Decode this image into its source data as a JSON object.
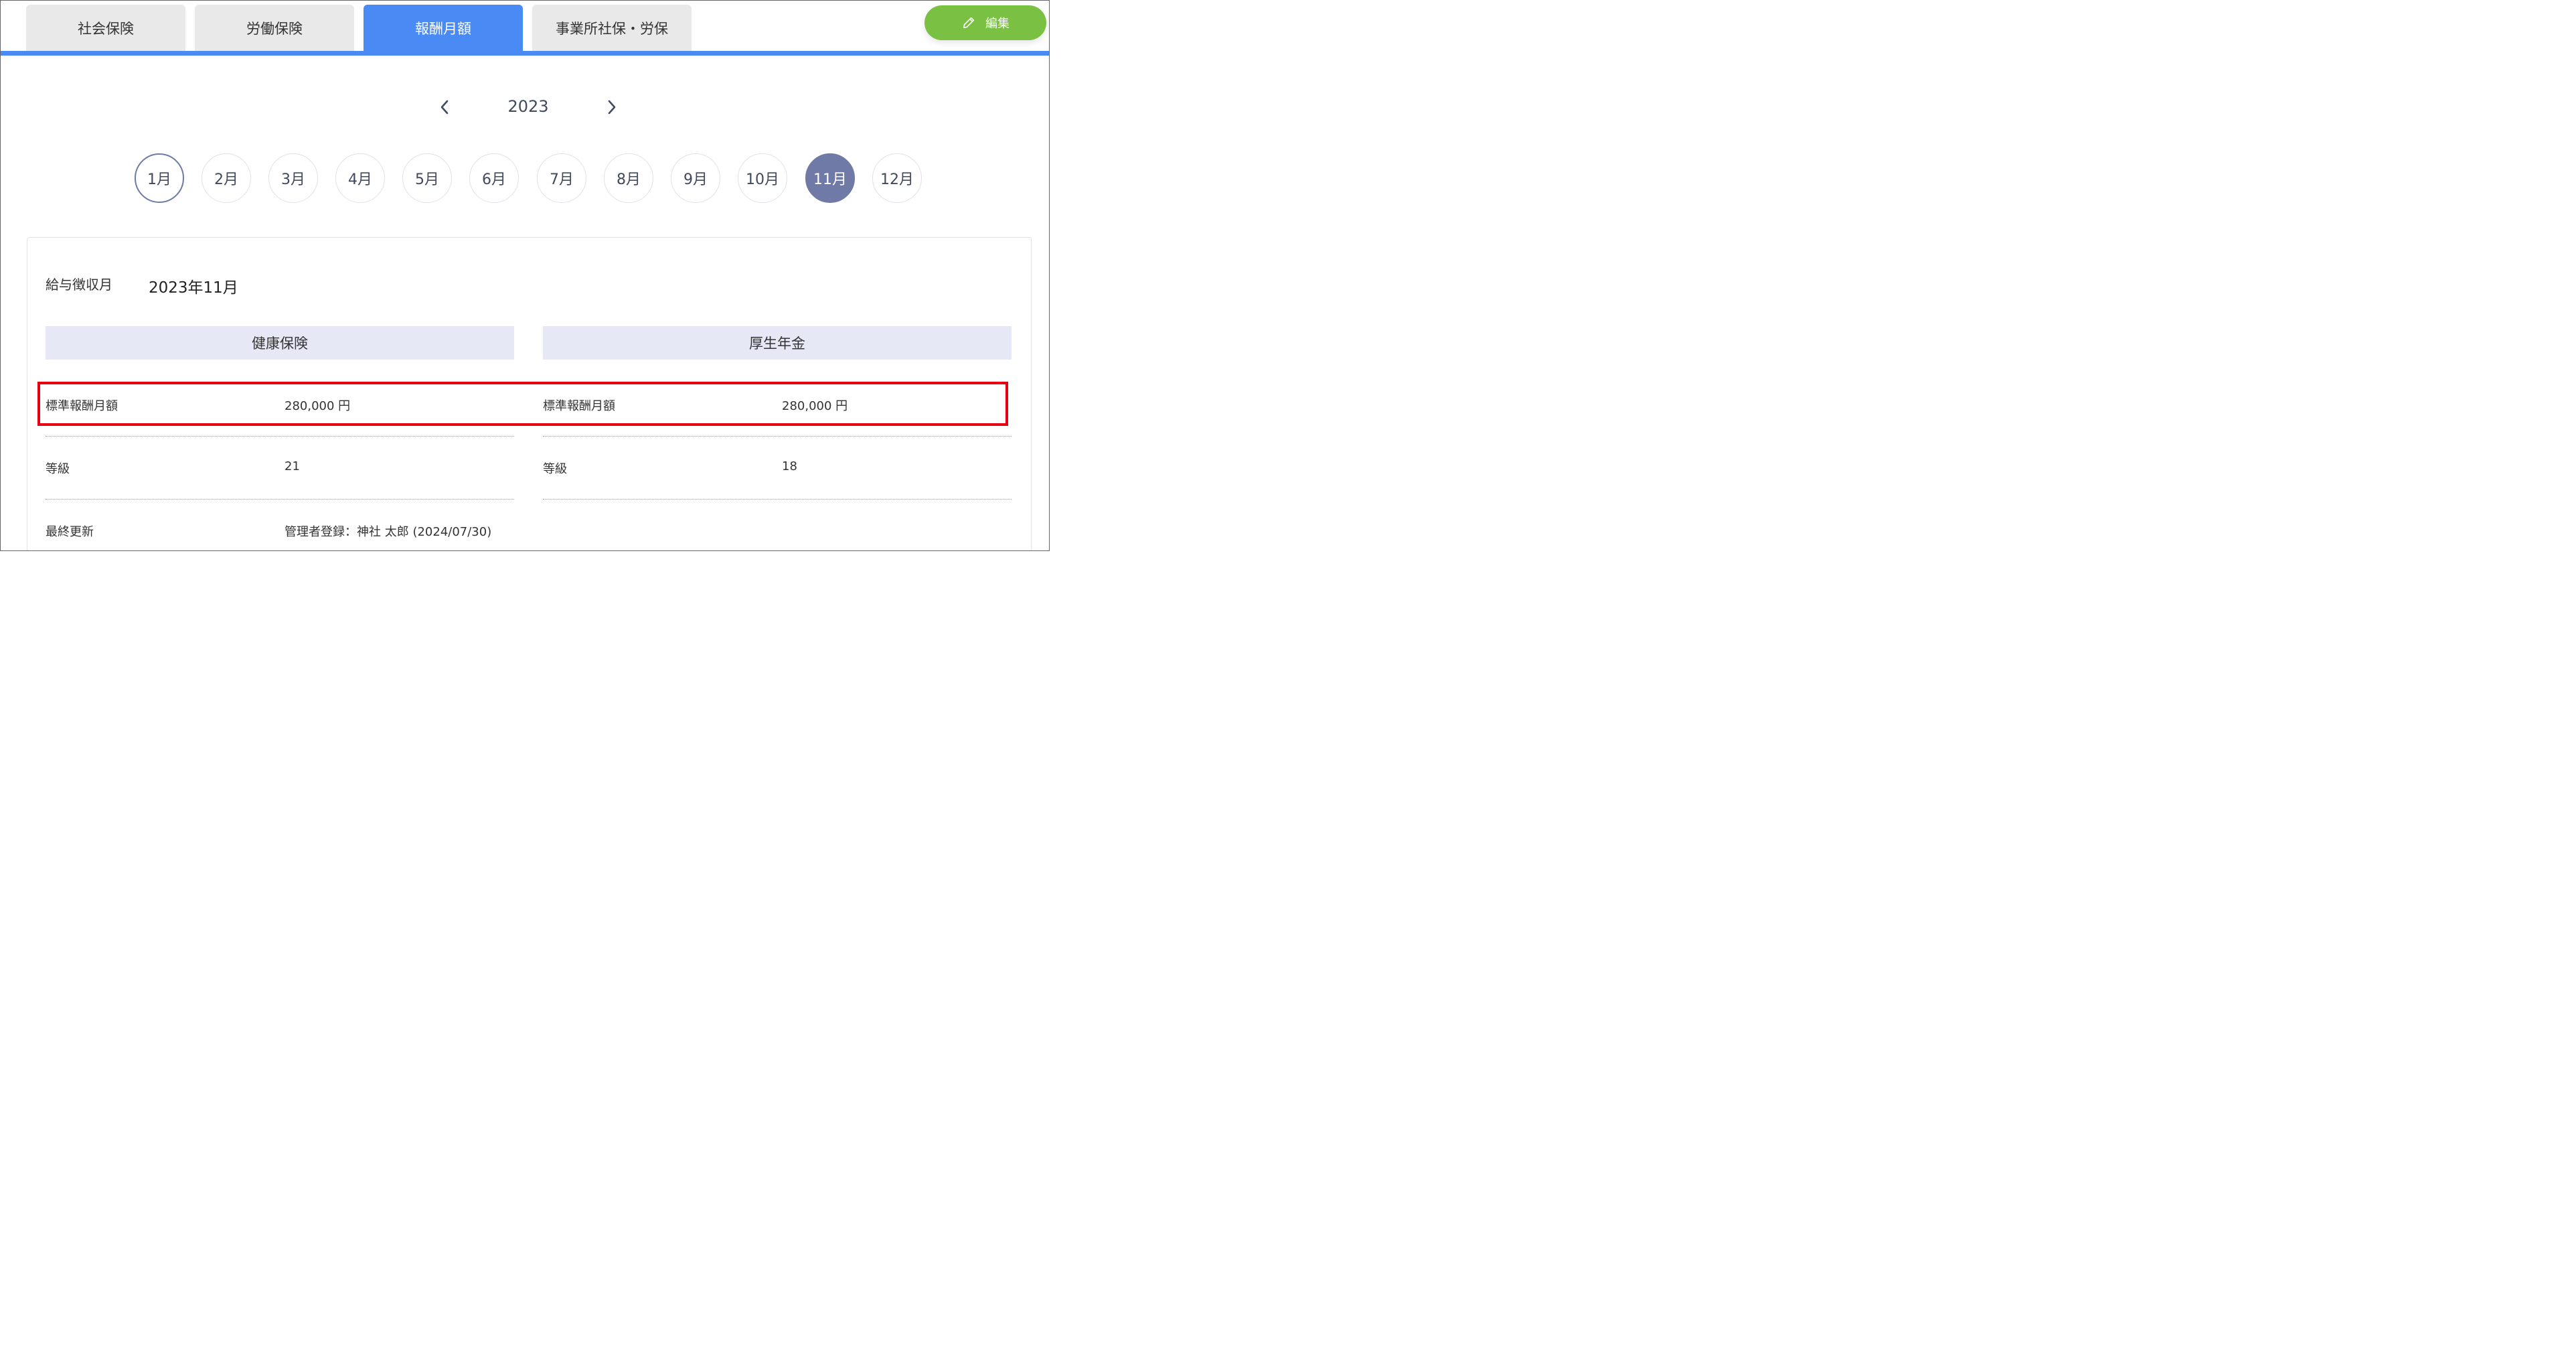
{
  "tabs": [
    {
      "label": "社会保険"
    },
    {
      "label": "労働保険"
    },
    {
      "label": "報酬月額"
    },
    {
      "label": "事業所社保・労保"
    }
  ],
  "edit_button": {
    "label": "編集",
    "icon": "pencil-icon"
  },
  "year_nav": {
    "year": "2023",
    "prev_icon": "chevron-left-icon",
    "next_icon": "chevron-right-icon"
  },
  "months": [
    "1月",
    "2月",
    "3月",
    "4月",
    "5月",
    "6月",
    "7月",
    "8月",
    "9月",
    "10月",
    "11月",
    "12月"
  ],
  "selected_month": "11月",
  "pay_month": {
    "label": "給与徴収月",
    "value": "2023年11月"
  },
  "health_insurance": {
    "title": "健康保険",
    "standard_label": "標準報酬月額",
    "standard_value": "280,000 円",
    "grade_label": "等級",
    "grade_value": "21",
    "updated_label": "最終更新",
    "updated_value": "管理者登録：神社 太郎 (2024/07/30)"
  },
  "pension": {
    "title": "厚生年金",
    "standard_label": "標準報酬月額",
    "standard_value": "280,000 円",
    "grade_label": "等級",
    "grade_value": "18"
  },
  "colors": {
    "tab_active": "#4a8af4",
    "edit_button": "#7ac143",
    "month_selected": "#6f7aa6",
    "section_header": "#e6e9f5",
    "highlight": "#e60012"
  }
}
